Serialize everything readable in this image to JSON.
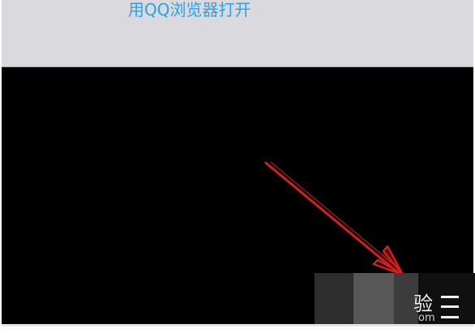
{
  "menu": {
    "open_in_qq_browser": "用QQ浏览器打开"
  },
  "colors": {
    "menu_background": "#d9d9de",
    "menu_text": "#2aa2e8",
    "content_background": "#000000",
    "annotation_arrow": "#d42020"
  },
  "annotation": {
    "icon": "red-arrow-icon"
  },
  "watermark": {
    "text_char": "验",
    "text_suffix": "om",
    "icon": "menu-lines-icon"
  }
}
